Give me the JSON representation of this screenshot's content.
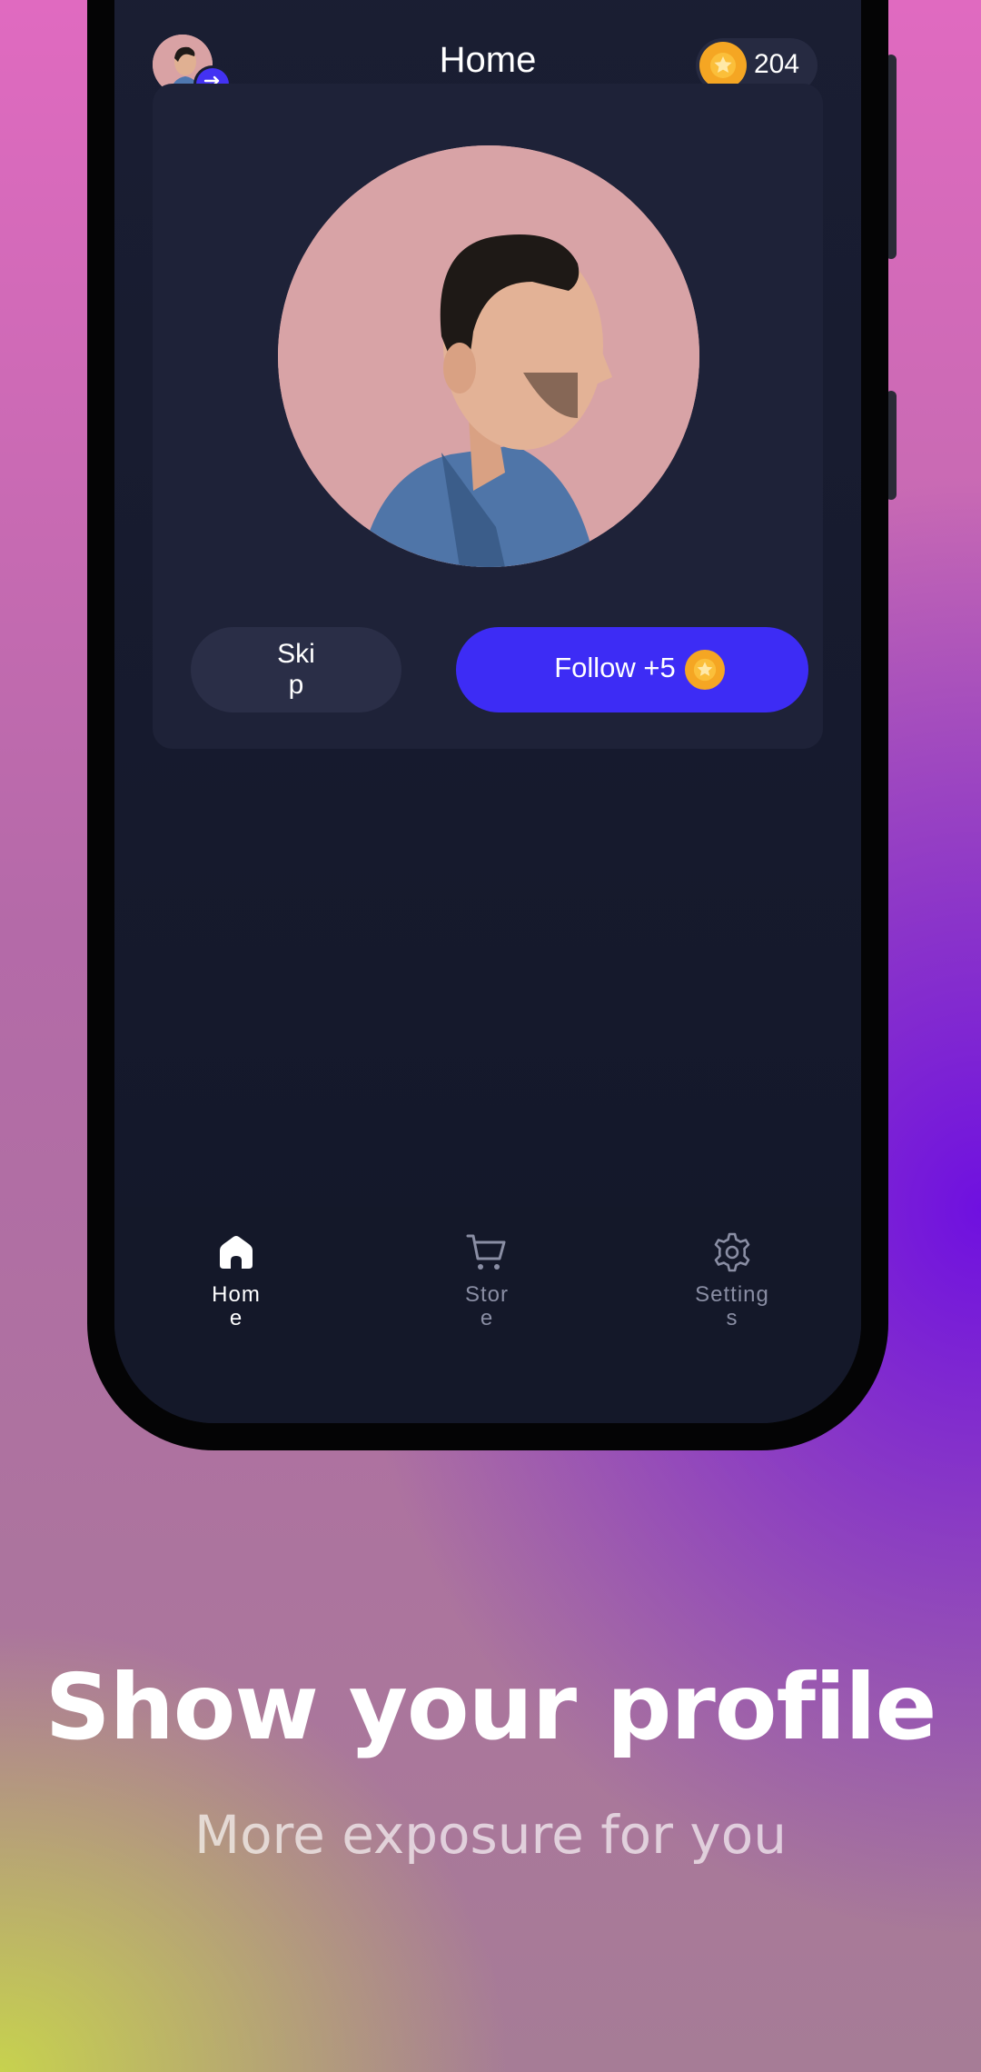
{
  "header": {
    "title": "Home",
    "coin_count": "204"
  },
  "actions": {
    "skip_label": "Skip",
    "follow_label": "Follow +5"
  },
  "nav": {
    "items": [
      {
        "label": "Home",
        "icon": "home-icon",
        "active": true
      },
      {
        "label": "Store",
        "icon": "cart-icon",
        "active": false
      },
      {
        "label": "Settings",
        "icon": "gear-icon",
        "active": false
      }
    ]
  },
  "promo": {
    "headline": "Show your profile",
    "subline": "More exposure for you"
  },
  "colors": {
    "accent": "#3d2cf5",
    "coin": "#f5a623",
    "background": "#131729"
  }
}
